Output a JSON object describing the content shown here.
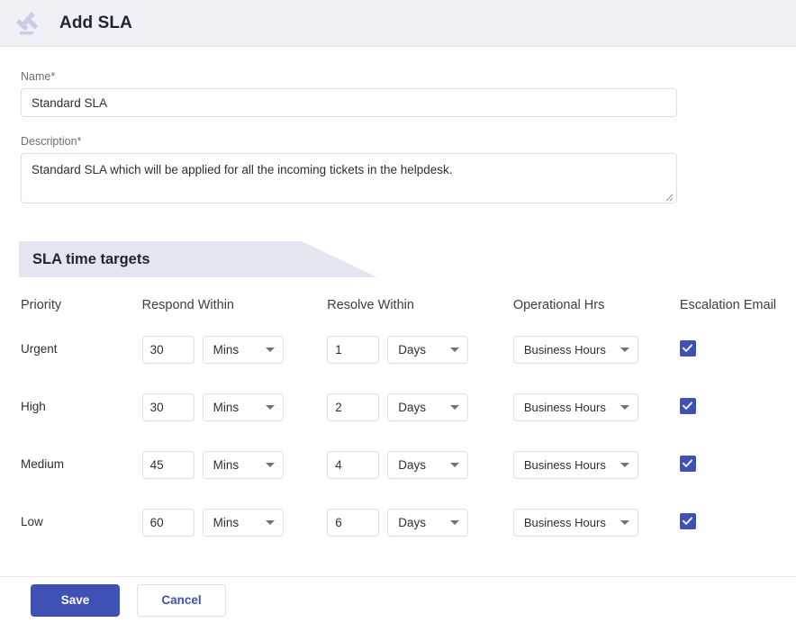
{
  "header": {
    "icon": "gavel-icon",
    "title": "Add SLA",
    "background": "#f0f1f6"
  },
  "form": {
    "name": {
      "label": "Name*",
      "value": "Standard SLA",
      "placeholder": ""
    },
    "description": {
      "label": "Description*",
      "value": "Standard SLA which will be applied for all the incoming tickets in the helpdesk.",
      "placeholder": ""
    }
  },
  "section": {
    "ribbon_title": "SLA time targets",
    "ribbon_color": "#e3e5ef"
  },
  "table": {
    "columns": [
      "Priority",
      "Respond Within",
      "Resolve Within",
      "Operational Hrs",
      "Escalation Email"
    ],
    "rows": [
      {
        "priority": "Urgent",
        "respond_value": "30",
        "respond_unit": "Mins",
        "resolve_value": "1",
        "resolve_unit": "Days",
        "operational_hrs": "Business Hours",
        "escalation_email": true
      },
      {
        "priority": "High",
        "respond_value": "30",
        "respond_unit": "Mins",
        "resolve_value": "2",
        "resolve_unit": "Days",
        "operational_hrs": "Business Hours",
        "escalation_email": true
      },
      {
        "priority": "Medium",
        "respond_value": "45",
        "respond_unit": "Mins",
        "resolve_value": "4",
        "resolve_unit": "Days",
        "operational_hrs": "Business Hours",
        "escalation_email": true
      },
      {
        "priority": "Low",
        "respond_value": "60",
        "respond_unit": "Mins",
        "resolve_value": "6",
        "resolve_unit": "Days",
        "operational_hrs": "Business Hours",
        "escalation_email": true
      }
    ]
  },
  "footer": {
    "save_label": "Save",
    "cancel_label": "Cancel",
    "accent_color": "#3f51b5"
  }
}
